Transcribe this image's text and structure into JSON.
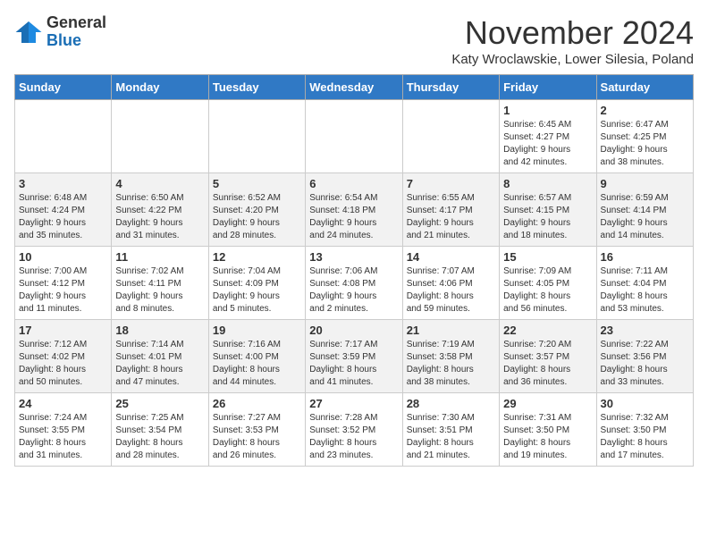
{
  "logo": {
    "general": "General",
    "blue": "Blue"
  },
  "title": "November 2024",
  "subtitle": "Katy Wroclawskie, Lower Silesia, Poland",
  "headers": [
    "Sunday",
    "Monday",
    "Tuesday",
    "Wednesday",
    "Thursday",
    "Friday",
    "Saturday"
  ],
  "weeks": [
    [
      {
        "day": "",
        "info": ""
      },
      {
        "day": "",
        "info": ""
      },
      {
        "day": "",
        "info": ""
      },
      {
        "day": "",
        "info": ""
      },
      {
        "day": "",
        "info": ""
      },
      {
        "day": "1",
        "info": "Sunrise: 6:45 AM\nSunset: 4:27 PM\nDaylight: 9 hours\nand 42 minutes."
      },
      {
        "day": "2",
        "info": "Sunrise: 6:47 AM\nSunset: 4:25 PM\nDaylight: 9 hours\nand 38 minutes."
      }
    ],
    [
      {
        "day": "3",
        "info": "Sunrise: 6:48 AM\nSunset: 4:24 PM\nDaylight: 9 hours\nand 35 minutes."
      },
      {
        "day": "4",
        "info": "Sunrise: 6:50 AM\nSunset: 4:22 PM\nDaylight: 9 hours\nand 31 minutes."
      },
      {
        "day": "5",
        "info": "Sunrise: 6:52 AM\nSunset: 4:20 PM\nDaylight: 9 hours\nand 28 minutes."
      },
      {
        "day": "6",
        "info": "Sunrise: 6:54 AM\nSunset: 4:18 PM\nDaylight: 9 hours\nand 24 minutes."
      },
      {
        "day": "7",
        "info": "Sunrise: 6:55 AM\nSunset: 4:17 PM\nDaylight: 9 hours\nand 21 minutes."
      },
      {
        "day": "8",
        "info": "Sunrise: 6:57 AM\nSunset: 4:15 PM\nDaylight: 9 hours\nand 18 minutes."
      },
      {
        "day": "9",
        "info": "Sunrise: 6:59 AM\nSunset: 4:14 PM\nDaylight: 9 hours\nand 14 minutes."
      }
    ],
    [
      {
        "day": "10",
        "info": "Sunrise: 7:00 AM\nSunset: 4:12 PM\nDaylight: 9 hours\nand 11 minutes."
      },
      {
        "day": "11",
        "info": "Sunrise: 7:02 AM\nSunset: 4:11 PM\nDaylight: 9 hours\nand 8 minutes."
      },
      {
        "day": "12",
        "info": "Sunrise: 7:04 AM\nSunset: 4:09 PM\nDaylight: 9 hours\nand 5 minutes."
      },
      {
        "day": "13",
        "info": "Sunrise: 7:06 AM\nSunset: 4:08 PM\nDaylight: 9 hours\nand 2 minutes."
      },
      {
        "day": "14",
        "info": "Sunrise: 7:07 AM\nSunset: 4:06 PM\nDaylight: 8 hours\nand 59 minutes."
      },
      {
        "day": "15",
        "info": "Sunrise: 7:09 AM\nSunset: 4:05 PM\nDaylight: 8 hours\nand 56 minutes."
      },
      {
        "day": "16",
        "info": "Sunrise: 7:11 AM\nSunset: 4:04 PM\nDaylight: 8 hours\nand 53 minutes."
      }
    ],
    [
      {
        "day": "17",
        "info": "Sunrise: 7:12 AM\nSunset: 4:02 PM\nDaylight: 8 hours\nand 50 minutes."
      },
      {
        "day": "18",
        "info": "Sunrise: 7:14 AM\nSunset: 4:01 PM\nDaylight: 8 hours\nand 47 minutes."
      },
      {
        "day": "19",
        "info": "Sunrise: 7:16 AM\nSunset: 4:00 PM\nDaylight: 8 hours\nand 44 minutes."
      },
      {
        "day": "20",
        "info": "Sunrise: 7:17 AM\nSunset: 3:59 PM\nDaylight: 8 hours\nand 41 minutes."
      },
      {
        "day": "21",
        "info": "Sunrise: 7:19 AM\nSunset: 3:58 PM\nDaylight: 8 hours\nand 38 minutes."
      },
      {
        "day": "22",
        "info": "Sunrise: 7:20 AM\nSunset: 3:57 PM\nDaylight: 8 hours\nand 36 minutes."
      },
      {
        "day": "23",
        "info": "Sunrise: 7:22 AM\nSunset: 3:56 PM\nDaylight: 8 hours\nand 33 minutes."
      }
    ],
    [
      {
        "day": "24",
        "info": "Sunrise: 7:24 AM\nSunset: 3:55 PM\nDaylight: 8 hours\nand 31 minutes."
      },
      {
        "day": "25",
        "info": "Sunrise: 7:25 AM\nSunset: 3:54 PM\nDaylight: 8 hours\nand 28 minutes."
      },
      {
        "day": "26",
        "info": "Sunrise: 7:27 AM\nSunset: 3:53 PM\nDaylight: 8 hours\nand 26 minutes."
      },
      {
        "day": "27",
        "info": "Sunrise: 7:28 AM\nSunset: 3:52 PM\nDaylight: 8 hours\nand 23 minutes."
      },
      {
        "day": "28",
        "info": "Sunrise: 7:30 AM\nSunset: 3:51 PM\nDaylight: 8 hours\nand 21 minutes."
      },
      {
        "day": "29",
        "info": "Sunrise: 7:31 AM\nSunset: 3:50 PM\nDaylight: 8 hours\nand 19 minutes."
      },
      {
        "day": "30",
        "info": "Sunrise: 7:32 AM\nSunset: 3:50 PM\nDaylight: 8 hours\nand 17 minutes."
      }
    ]
  ]
}
